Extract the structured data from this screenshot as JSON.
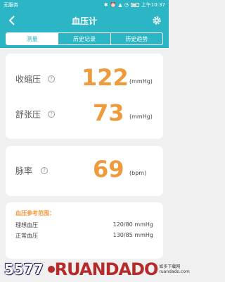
{
  "status_bar": {
    "carrier": "无服务",
    "time": "上午10:37"
  },
  "header": {
    "title": "血压计"
  },
  "tabs": [
    {
      "label": "测量",
      "active": true
    },
    {
      "label": "历史记录",
      "active": false
    },
    {
      "label": "历史趋势",
      "active": false
    }
  ],
  "readings": {
    "systolic": {
      "label": "收缩压",
      "value": "122",
      "unit": "(mmHg)"
    },
    "diastolic": {
      "label": "舒张压",
      "value": "73",
      "unit": "(mmHg)"
    },
    "pulse": {
      "label": "脉率",
      "value": "69",
      "unit": "(bpm)"
    }
  },
  "reference": {
    "title": "血压参考范围：",
    "rows": [
      {
        "label": "理想血压",
        "value": "120/80 mmHg"
      },
      {
        "label": "正常血压",
        "value": "130/85 mmHg"
      }
    ]
  },
  "watermark": {
    "left": "5577",
    "brand": "RUANDADO",
    "sub_top": "如多下载网",
    "sub_bottom": "ruandado.com"
  },
  "colors": {
    "accent": "#2cb5c4",
    "value": "#f09a3e"
  }
}
